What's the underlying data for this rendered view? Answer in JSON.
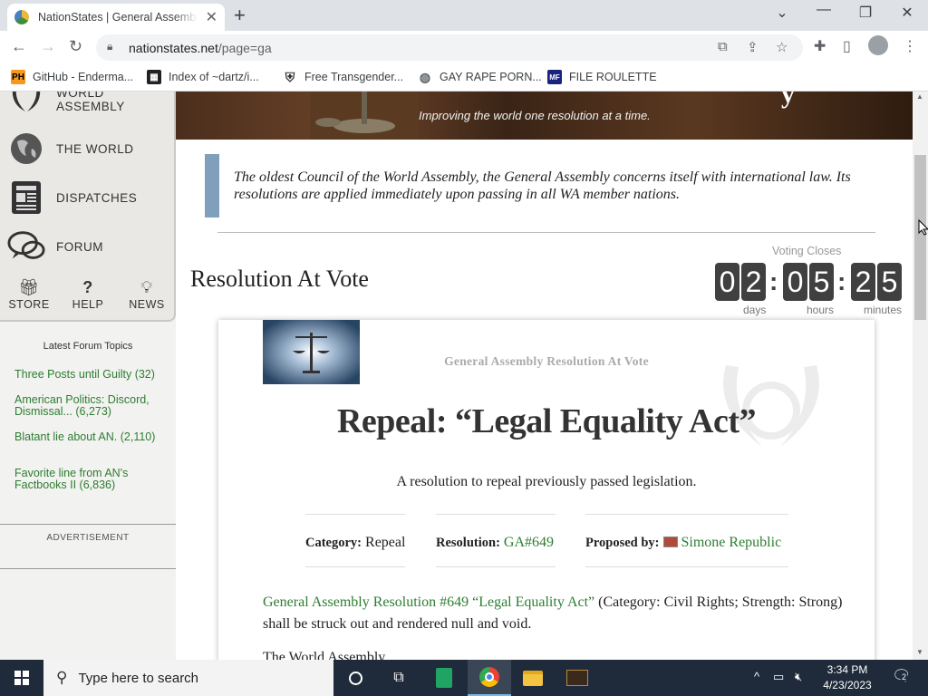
{
  "browser": {
    "tab_title": "NationStates | General Assembly",
    "new_tab": "+",
    "url_host": "nationstates.net",
    "url_path": "/page=ga",
    "bookmarks": [
      {
        "icon": "PH",
        "label": "GitHub - Enderma..."
      },
      {
        "icon": "grid",
        "label": "Index of ~dartz/i..."
      },
      {
        "icon": "shield",
        "label": "Free Transgender..."
      },
      {
        "icon": "globe",
        "label": "GAY RAPE PORN..."
      },
      {
        "icon": "MF",
        "label": "FILE ROULETTE"
      }
    ]
  },
  "sidebar": {
    "nav": [
      {
        "label": "WORLD ASSEMBLY",
        "icon": "laurel-icon"
      },
      {
        "label": "THE WORLD",
        "icon": "globe-icon"
      },
      {
        "label": "DISPATCHES",
        "icon": "newspaper-icon"
      },
      {
        "label": "FORUM",
        "icon": "speech-bubbles-icon"
      }
    ],
    "small_nav": [
      {
        "label": "STORE",
        "icon": "gift-icon"
      },
      {
        "label": "HELP",
        "icon": "question-icon"
      },
      {
        "label": "NEWS",
        "icon": "lightbulb-icon"
      }
    ],
    "forum_heading": "Latest Forum Topics",
    "forum_topics": [
      "Three Posts until Guilty (32)",
      "American Politics: Discord, Dismissal... (6,273)",
      "Blatant lie about AN. (2,110)",
      "Favorite line from AN's Factbooks II (6,836)"
    ],
    "ad_label": "ADVERTISEMENT"
  },
  "banner": {
    "tagline": "Improving the world one resolution at a time.",
    "partial_glyph": "y"
  },
  "intro_text": "The oldest Council of the World Assembly, the General Assembly concerns itself with international law. Its resolutions are applied immediately upon passing in all WA member nations.",
  "resolution_heading": "Resolution At Vote",
  "voting_clock": {
    "label": "Voting Closes",
    "digits": [
      "0",
      "2",
      "0",
      "5",
      "2",
      "5"
    ],
    "separator": ":",
    "units": [
      "days",
      "hours",
      "minutes"
    ]
  },
  "resolution": {
    "kicker": "General Assembly Resolution At Vote",
    "title": "Repeal: “Legal Equality Act”",
    "subtitle": "A resolution to repeal previously passed legislation.",
    "category_label": "Category:",
    "category_value": "Repeal",
    "resolution_label": "Resolution:",
    "resolution_value": "GA#649",
    "proposed_label": "Proposed by:",
    "proposed_value": "Simone Republic",
    "body_link": "General Assembly Resolution #649 “Legal Equality Act”",
    "body_text": " (Category: Civil Rights; Strength: Strong) shall be struck out and rendered null and void.",
    "next_line": "The World Assembly,"
  },
  "taskbar": {
    "search_placeholder": "Type here to search",
    "time": "3:34 PM",
    "date": "4/23/2023",
    "notification_count": "2"
  },
  "colors": {
    "link_green": "#2e7d32",
    "intro_bar": "#7f9fbd",
    "clock_digit_bg": "#404040",
    "taskbar_bg": "#1f2b3a"
  }
}
